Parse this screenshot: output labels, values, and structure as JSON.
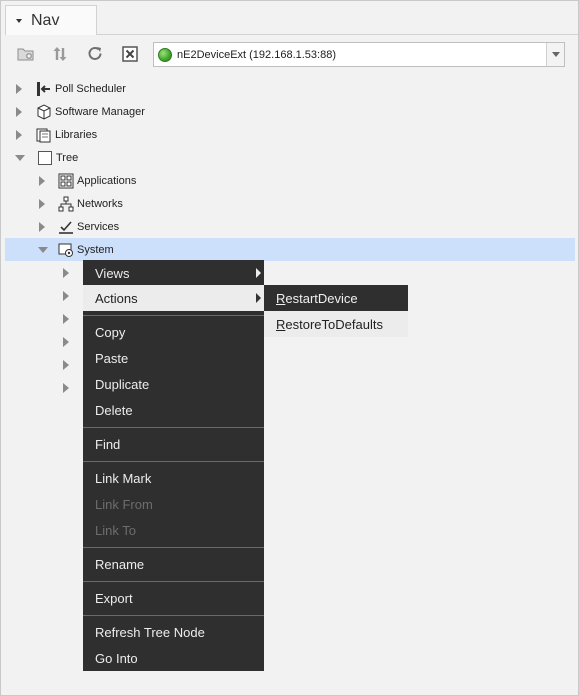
{
  "panel": {
    "title": "Nav"
  },
  "toolbar": {
    "station_label": "nE2DeviceExt (192.168.1.53:88)"
  },
  "tree": {
    "items": [
      {
        "label": "Poll Scheduler",
        "expanded": false
      },
      {
        "label": "Software Manager",
        "expanded": false
      },
      {
        "label": "Libraries",
        "expanded": false
      },
      {
        "label": "Tree",
        "expanded": true
      },
      {
        "label": "Applications",
        "expanded": false
      },
      {
        "label": "Networks",
        "expanded": false
      },
      {
        "label": "Services",
        "expanded": false
      },
      {
        "label": "System",
        "expanded": true,
        "selected": true
      }
    ]
  },
  "context_menu": {
    "items": [
      {
        "label": "Views",
        "submenu": true
      },
      {
        "label": "Actions",
        "submenu": true,
        "highlighted": true
      },
      {
        "label": "Copy"
      },
      {
        "label": "Paste"
      },
      {
        "label": "Duplicate"
      },
      {
        "label": "Delete"
      },
      {
        "label": "Find"
      },
      {
        "label": "Link Mark"
      },
      {
        "label": "Link From",
        "disabled": true
      },
      {
        "label": "Link To",
        "disabled": true
      },
      {
        "label": "Rename"
      },
      {
        "label": "Export"
      },
      {
        "label": "Refresh Tree Node"
      },
      {
        "label": "Go Into"
      }
    ]
  },
  "actions_submenu": {
    "items": [
      {
        "label_first": "R",
        "label_rest": "estartDevice"
      },
      {
        "label_first": "R",
        "label_rest": "estoreToDefaults"
      }
    ]
  }
}
